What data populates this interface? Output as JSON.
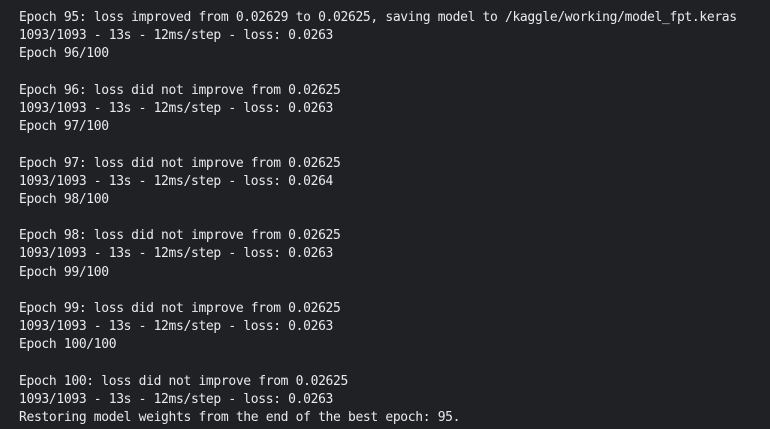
{
  "output": {
    "lines": [
      "Epoch 95: loss improved from 0.02629 to 0.02625, saving model to /kaggle/working/model_fpt.keras",
      "1093/1093 - 13s - 12ms/step - loss: 0.0263",
      "Epoch 96/100",
      "",
      "Epoch 96: loss did not improve from 0.02625",
      "1093/1093 - 13s - 12ms/step - loss: 0.0263",
      "Epoch 97/100",
      "",
      "Epoch 97: loss did not improve from 0.02625",
      "1093/1093 - 13s - 12ms/step - loss: 0.0264",
      "Epoch 98/100",
      "",
      "Epoch 98: loss did not improve from 0.02625",
      "1093/1093 - 13s - 12ms/step - loss: 0.0263",
      "Epoch 99/100",
      "",
      "Epoch 99: loss did not improve from 0.02625",
      "1093/1093 - 13s - 12ms/step - loss: 0.0263",
      "Epoch 100/100",
      "",
      "Epoch 100: loss did not improve from 0.02625",
      "1093/1093 - 13s - 12ms/step - loss: 0.0263",
      "Restoring model weights from the end of the best epoch: 95."
    ]
  },
  "colors": {
    "background": "#202124",
    "text": "#e8eaed"
  }
}
